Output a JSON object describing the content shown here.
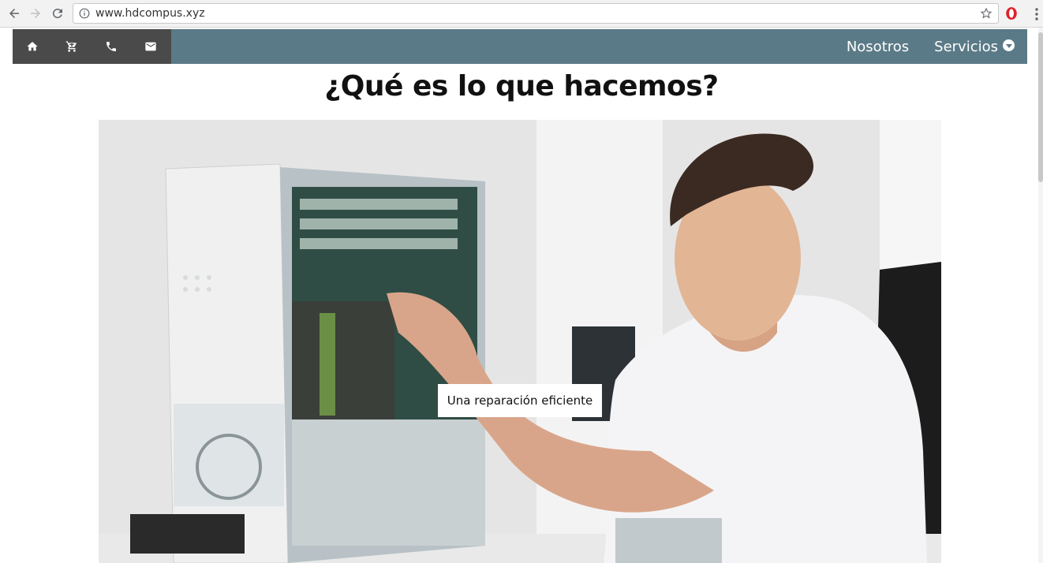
{
  "browser": {
    "url": "www.hdcompus.xyz",
    "icons": [
      "back-icon",
      "forward-icon",
      "reload-icon",
      "info-icon",
      "star-icon",
      "opera-icon",
      "menu-icon"
    ]
  },
  "site_nav": {
    "icons": [
      "home-icon",
      "cart-icon",
      "phone-icon",
      "mail-icon"
    ],
    "menu": {
      "nosotros": "Nosotros",
      "servicios": "Servicios"
    },
    "colors": {
      "bar": "#5b7a87",
      "icon_block": "#4a4a4a"
    }
  },
  "main": {
    "heading": "¿Qué es lo que hacemos?",
    "hero": {
      "image_alt": "Técnico reparando una computadora",
      "cta_label": "Una reparación eficiente"
    }
  }
}
